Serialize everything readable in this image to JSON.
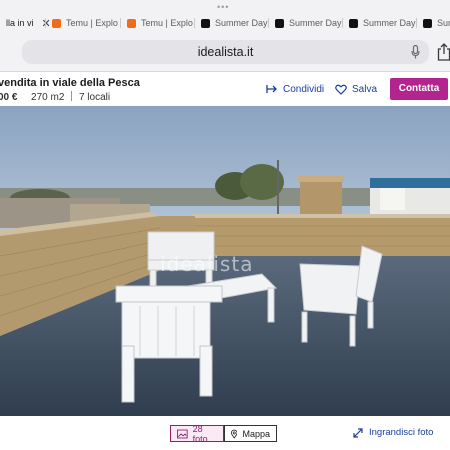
{
  "browser": {
    "more_dots": "•••",
    "tabs": [
      {
        "label": "lla in vi",
        "active": true,
        "favicon_color": "#b3248e"
      },
      {
        "label": "Temu | Explo",
        "active": false,
        "favicon_color": "#f26b1d"
      },
      {
        "label": "Temu | Explo",
        "active": false,
        "favicon_color": "#f26b1d"
      },
      {
        "label": "Summer Day",
        "active": false,
        "favicon_color": "#111111"
      },
      {
        "label": "Summer Day",
        "active": false,
        "favicon_color": "#111111"
      },
      {
        "label": "Summer Day",
        "active": false,
        "favicon_color": "#111111"
      },
      {
        "label": "Sum",
        "active": false,
        "favicon_color": "#111111"
      }
    ],
    "close_glyph": "✕",
    "address": "idealista.it"
  },
  "listing": {
    "title": "vendita in viale della Pesca",
    "price": "00 €",
    "area": "270 m2",
    "rooms": "7 locali",
    "share_label": "Condividi",
    "save_label": "Salva",
    "contact_label": "Contatta"
  },
  "photo": {
    "watermark": "idealista"
  },
  "bottom": {
    "photos_label": "28 foto",
    "map_label": "Mappa",
    "enlarge_label": "Ingrandisci foto"
  },
  "colors": {
    "brand": "#b3248e",
    "link": "#1a3e9e"
  }
}
